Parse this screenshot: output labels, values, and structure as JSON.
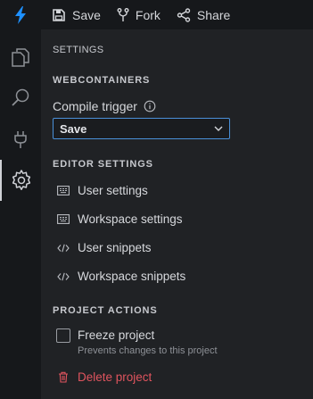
{
  "toolbar": {
    "save_label": "Save",
    "fork_label": "Fork",
    "share_label": "Share"
  },
  "activity_bar": {
    "items": [
      "explorer",
      "search",
      "ports",
      "settings"
    ],
    "active": "settings"
  },
  "panel": {
    "title": "SETTINGS",
    "webcontainers": {
      "heading": "WEBCONTAINERS",
      "compile_trigger_label": "Compile trigger",
      "compile_trigger_value": "Save"
    },
    "editor_settings": {
      "heading": "EDITOR SETTINGS",
      "items": [
        "User settings",
        "Workspace settings",
        "User snippets",
        "Workspace snippets"
      ]
    },
    "project_actions": {
      "heading": "PROJECT ACTIONS",
      "freeze_label": "Freeze project",
      "freeze_description": "Prevents changes to this project",
      "freeze_checked": false,
      "delete_label": "Delete project"
    }
  },
  "colors": {
    "accent": "#4a90d9",
    "logo": "#1e90ff",
    "danger": "#e0545e"
  }
}
